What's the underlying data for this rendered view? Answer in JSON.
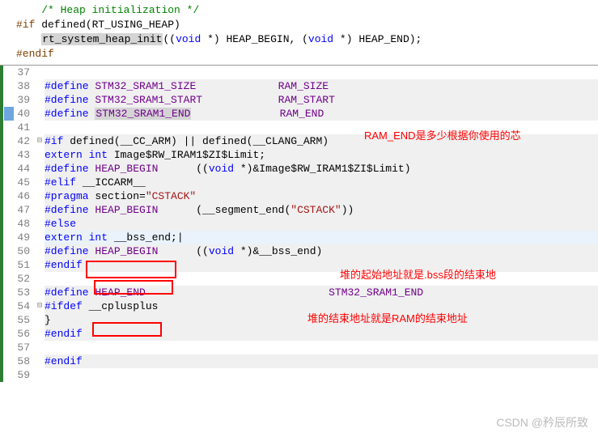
{
  "top": {
    "comment": "/* Heap initialization */",
    "line1a": "#if",
    "line1b": " defined(RT_USING_HEAP)",
    "line2a": "rt_system_heap_init",
    "line2b": "((",
    "line2c": "void",
    "line2d": " *) HEAP_BEGIN, (",
    "line2e": "void",
    "line2f": " *) HEAP_END);",
    "line3": "#endif"
  },
  "lines": {
    "l37": "37",
    "l38": "38",
    "l39": "39",
    "l40": "40",
    "l41": "41",
    "l42": "42",
    "l43": "43",
    "l44": "44",
    "l45": "45",
    "l46": "46",
    "l47": "47",
    "l48": "48",
    "l49": "49",
    "l50": "50",
    "l51": "51",
    "l52": "52",
    "l53": "53",
    "l54": "54",
    "l55": "55",
    "l56": "56",
    "l57": "57",
    "l58": "58",
    "l59": "59"
  },
  "c": {
    "define": "#define",
    "if": "#if",
    "elif": "#elif",
    "else": "#else",
    "endif": "#endif",
    "ifdef": "#ifdef",
    "pragma": "#pragma",
    "extern": "extern",
    "int": "int",
    "void": "void",
    "sram1size": "STM32_SRAM1_SIZE",
    "sram1start": "STM32_SRAM1_START",
    "sram1end": "STM32_SRAM1_END",
    "ramsize": "RAM_SIZE",
    "ramstart": "RAM_START",
    "ramend": "RAM_END",
    "l42b": " defined(__CC_ARM) || defined(__CLANG_ARM)",
    "l43b": " Image$RW_IRAM1$ZI$Limit;",
    "heapbegin": "HEAP_BEGIN",
    "heapend": "HEAP_END",
    "l44c": "((",
    "l44d": " *)&Image$RW_IRAM1$ZI$Limit)",
    "iccarm": " __ICCARM__",
    "section": " section=",
    "cstack": "\"CSTACK\"",
    "l47c": "(__segment_end(",
    "l47e": "))",
    "bssend": " __bss_end;",
    "l50c": "((",
    "l50d": " *)&__bss_end)",
    "cplusplus": " __cplusplus",
    "brace": "}",
    "cursor": "|"
  },
  "annotations": {
    "a1": "RAM_END是多少根据你使用的芯",
    "a2": "堆的起始地址就是.bss段的结束地",
    "a3": "堆的结束地址就是RAM的结束地址"
  },
  "watermark": "CSDN @矜辰所致",
  "sp": {
    "s12": "            ",
    "s13": "             ",
    "s6": "      ",
    "s4": "    ",
    "s29": "                             "
  }
}
